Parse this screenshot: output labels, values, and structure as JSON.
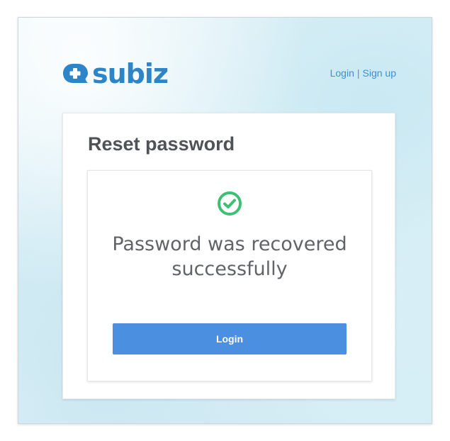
{
  "brand": {
    "name": "subiz",
    "logo_icon": "chat-bubble-plus-icon",
    "color": "#2d84c7"
  },
  "header_links": {
    "login": "Login",
    "separator": "|",
    "signup": "Sign up",
    "color": "#3d8fd6"
  },
  "card": {
    "title": "Reset password",
    "status_icon": "check-circle-icon",
    "status_color": "#3fbf74",
    "message": "Password was recovered successfully",
    "login_button": "Login",
    "button_color": "#4a8fe0"
  }
}
